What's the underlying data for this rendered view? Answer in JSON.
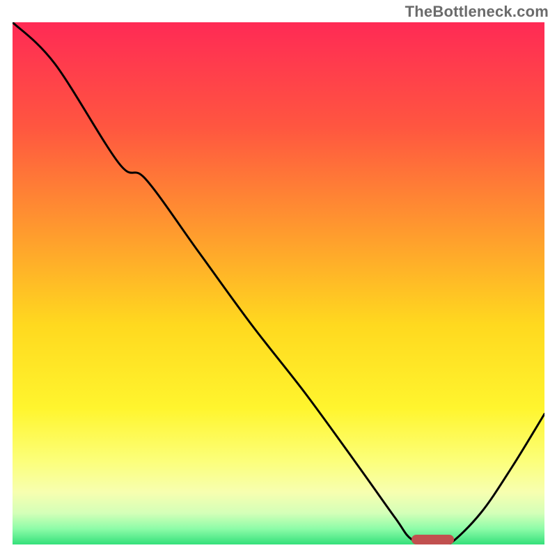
{
  "watermark": "TheBottleneck.com",
  "chart_data": {
    "type": "line",
    "title": "",
    "xlabel": "",
    "ylabel": "",
    "xlim": [
      0,
      100
    ],
    "ylim": [
      0,
      100
    ],
    "grid": false,
    "legend": false,
    "series": [
      {
        "name": "bottleneck-curve",
        "x": [
          0,
          8,
          20,
          25,
          35,
          45,
          55,
          65,
          72,
          75,
          79,
          82,
          88,
          94,
          100
        ],
        "values": [
          100,
          92,
          73,
          70,
          56,
          42,
          29,
          15,
          5,
          1,
          0,
          0,
          6,
          15,
          25
        ]
      }
    ],
    "marker": {
      "name": "sweet-spot",
      "x_start": 75,
      "x_end": 83,
      "y": 0,
      "color": "#c1504f"
    },
    "background_gradient": {
      "stops": [
        {
          "offset": 0.0,
          "color": "#ff2a55"
        },
        {
          "offset": 0.2,
          "color": "#ff5640"
        },
        {
          "offset": 0.4,
          "color": "#ff9a2e"
        },
        {
          "offset": 0.58,
          "color": "#ffd91f"
        },
        {
          "offset": 0.74,
          "color": "#fff52e"
        },
        {
          "offset": 0.84,
          "color": "#fcff7a"
        },
        {
          "offset": 0.9,
          "color": "#f7ffb0"
        },
        {
          "offset": 0.94,
          "color": "#d4ffb8"
        },
        {
          "offset": 0.97,
          "color": "#8dfca8"
        },
        {
          "offset": 1.0,
          "color": "#34e07a"
        }
      ]
    }
  }
}
